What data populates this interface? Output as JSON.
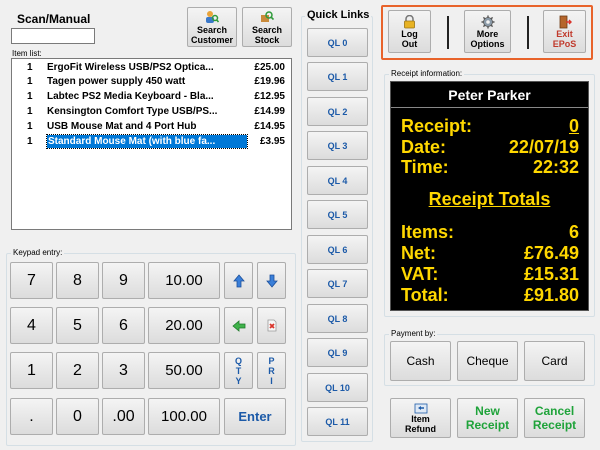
{
  "scan": {
    "label": "Scan/Manual",
    "value": ""
  },
  "toolbar": {
    "search_customer": [
      "Search",
      "Customer"
    ],
    "search_stock": [
      "Search",
      "Stock"
    ]
  },
  "item_list": {
    "label": "Item list:",
    "items": [
      {
        "qty": "1",
        "desc": "ErgoFit Wireless USB/PS2 Optica...",
        "price": "£25.00",
        "selected": false
      },
      {
        "qty": "1",
        "desc": "Tagen power supply 450 watt",
        "price": "£19.96",
        "selected": false
      },
      {
        "qty": "1",
        "desc": "Labtec PS2 Media Keyboard - Bla...",
        "price": "£12.95",
        "selected": false
      },
      {
        "qty": "1",
        "desc": "Kensington Comfort Type USB/PS...",
        "price": "£14.99",
        "selected": false
      },
      {
        "qty": "1",
        "desc": "USB Mouse Mat and 4 Port Hub",
        "price": "£14.95",
        "selected": false
      },
      {
        "qty": "1",
        "desc": "Standard Mouse Mat (with blue fa...",
        "price": "£3.95",
        "selected": true
      }
    ]
  },
  "keypad": {
    "label": "Keypad entry:",
    "keys": {
      "k7": "7",
      "k8": "8",
      "k9": "9",
      "k10": "10.00",
      "k4": "4",
      "k5": "5",
      "k6": "6",
      "k20": "20.00",
      "k1": "1",
      "k2": "2",
      "k3": "3",
      "k50": "50.00",
      "kdot": ".",
      "k0": "0",
      "k00": ".00",
      "k100": "100.00",
      "enter": "Enter",
      "qty": [
        "Q",
        "T",
        "Y"
      ],
      "pri": [
        "P",
        "R",
        "I"
      ]
    },
    "icons": [
      "arrow-up-icon",
      "arrow-down-icon",
      "arrow-left-icon",
      "delete-line-icon"
    ]
  },
  "quick_links": {
    "title": "Quick Links",
    "items": [
      "QL 0",
      "QL 1",
      "QL 2",
      "QL 3",
      "QL 4",
      "QL 5",
      "QL 6",
      "QL 7",
      "QL 8",
      "QL 9",
      "QL 10",
      "QL 11"
    ]
  },
  "top_actions": {
    "logout": [
      "Log",
      "Out"
    ],
    "more_options": [
      "More",
      "Options"
    ],
    "exit": [
      "Exit",
      "EPoS"
    ],
    "border_color": "#e8632b"
  },
  "receipt": {
    "label": "Receipt information:",
    "customer": "Peter Parker",
    "receipt_label": "Receipt:",
    "receipt_number": "0",
    "date_label": "Date:",
    "date": "22/07/19",
    "time_label": "Time:",
    "time": "22:32",
    "totals_title": "Receipt Totals",
    "items_label": "Items:",
    "items": "6",
    "net_label": "Net:",
    "net": "£76.49",
    "vat_label": "VAT:",
    "vat": "£15.31",
    "total_label": "Total:",
    "total": "£91.80",
    "text_color": "#ffd700",
    "background": "#000000"
  },
  "payment": {
    "label": "Payment by:",
    "cash": "Cash",
    "cheque": "Cheque",
    "card": "Card"
  },
  "bottom_actions": {
    "item_refund": [
      "Item",
      "Refund"
    ],
    "new_receipt": [
      "New",
      "Receipt"
    ],
    "cancel_receipt": [
      "Cancel",
      "Receipt"
    ],
    "accent": "#1fa33a"
  }
}
